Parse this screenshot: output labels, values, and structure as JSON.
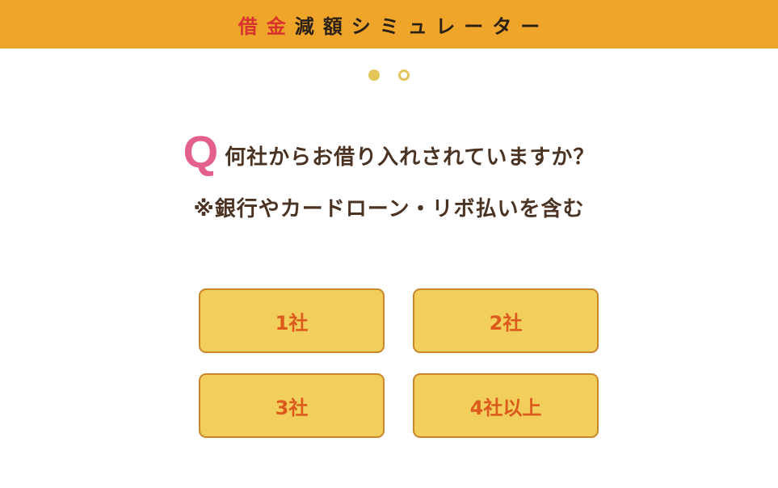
{
  "header": {
    "title_accent": "借金",
    "title_rest": "減額シミュレーター"
  },
  "progress": {
    "current_step": 1,
    "total_steps": 2
  },
  "question": {
    "marker": "Q",
    "text": "何社からお借り入れされていますか？",
    "note": "※銀行やカードローン・リボ払いを含む"
  },
  "choices": [
    {
      "label": "1社"
    },
    {
      "label": "2社"
    },
    {
      "label": "3社"
    },
    {
      "label": "4社以上"
    }
  ],
  "colors": {
    "header_bg": "#eea52a",
    "title_accent": "#d8322f",
    "dot": "#e3c65a",
    "q_marker": "#e25f8e",
    "button_bg": "#f2ce5c",
    "button_border": "#c9872a",
    "button_text": "#db5a1c"
  }
}
